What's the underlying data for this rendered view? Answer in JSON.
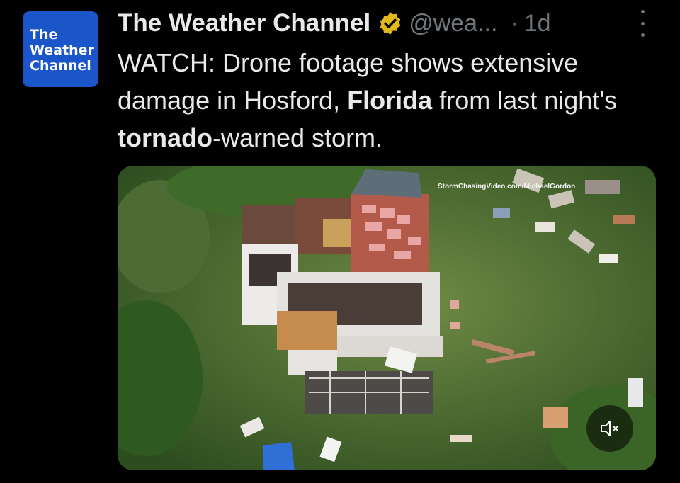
{
  "author": {
    "avatar_lines": [
      "The",
      "Weather",
      "Channel"
    ],
    "name": "The Weather Channel",
    "verified": true,
    "handle": "@wea...",
    "separator": "·",
    "time": "1d"
  },
  "post": {
    "text_1": "WATCH: Drone footage shows extensive damage in Hosford, ",
    "bold_1": "Florida",
    "text_2": " from last night's ",
    "bold_2": "tornado",
    "text_3": "-warned storm."
  },
  "media": {
    "watermark": "StormChasingVideo.com/MichaelGordon",
    "sound_state": "muted"
  },
  "icons": {
    "more": "more-icon",
    "verified": "verified-badge-icon",
    "mute": "speaker-muted-icon"
  },
  "colors": {
    "background": "#000000",
    "text": "#e7e9ea",
    "muted_text": "#71767b",
    "avatar_bg": "#1a56c9",
    "verified_gold": "#e2b719"
  }
}
